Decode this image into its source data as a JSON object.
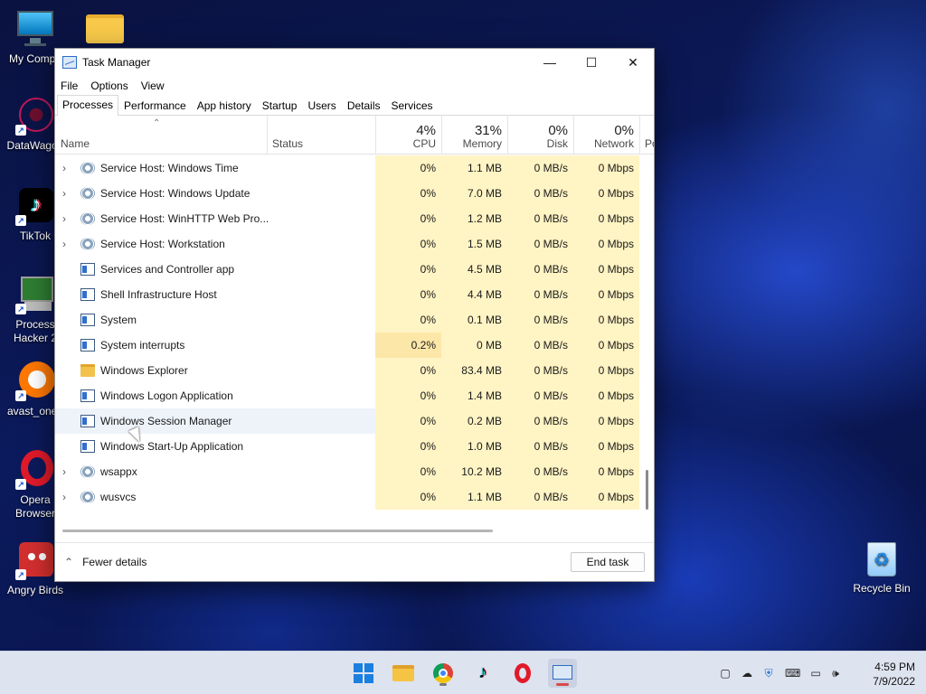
{
  "desktop": {
    "icons": [
      {
        "label": "My Compu",
        "icon": "monitor-icon"
      },
      {
        "label": "DataWagon",
        "icon": "datawagon-icon"
      },
      {
        "label": "TikTok",
        "icon": "tiktok-icon"
      },
      {
        "label": "Process Hacker 2",
        "icon": "process-hacker-icon"
      },
      {
        "label": "avast_one_",
        "icon": "avast-icon"
      },
      {
        "label": "Opera Browser",
        "icon": "opera-icon"
      },
      {
        "label": "Angry Birds",
        "icon": "angry-birds-icon"
      },
      {
        "label": "Recycle Bin",
        "icon": "recycle-bin-icon"
      }
    ]
  },
  "window": {
    "title": "Task Manager",
    "menu": [
      "File",
      "Options",
      "View"
    ],
    "tabs": [
      "Processes",
      "Performance",
      "App history",
      "Startup",
      "Users",
      "Details",
      "Services"
    ],
    "active_tab": "Processes",
    "columns": {
      "name": "Name",
      "status": "Status",
      "cpu": {
        "pct": "4%",
        "label": "CPU"
      },
      "memory": {
        "pct": "31%",
        "label": "Memory"
      },
      "disk": {
        "pct": "0%",
        "label": "Disk"
      },
      "network": {
        "pct": "0%",
        "label": "Network"
      },
      "power": "Po"
    },
    "rows": [
      {
        "name": "Service Host: Windows Time",
        "cpu": "0%",
        "memory": "1.1 MB",
        "disk": "0 MB/s",
        "network": "0 Mbps",
        "icon": "gear",
        "expandable": true
      },
      {
        "name": "Service Host: Windows Update",
        "cpu": "0%",
        "memory": "7.0 MB",
        "disk": "0 MB/s",
        "network": "0 Mbps",
        "icon": "gear",
        "expandable": true
      },
      {
        "name": "Service Host: WinHTTP Web Pro...",
        "cpu": "0%",
        "memory": "1.2 MB",
        "disk": "0 MB/s",
        "network": "0 Mbps",
        "icon": "gear",
        "expandable": true
      },
      {
        "name": "Service Host: Workstation",
        "cpu": "0%",
        "memory": "1.5 MB",
        "disk": "0 MB/s",
        "network": "0 Mbps",
        "icon": "gear",
        "expandable": true
      },
      {
        "name": "Services and Controller app",
        "cpu": "0%",
        "memory": "4.5 MB",
        "disk": "0 MB/s",
        "network": "0 Mbps",
        "icon": "window",
        "expandable": false
      },
      {
        "name": "Shell Infrastructure Host",
        "cpu": "0%",
        "memory": "4.4 MB",
        "disk": "0 MB/s",
        "network": "0 Mbps",
        "icon": "window",
        "expandable": false
      },
      {
        "name": "System",
        "cpu": "0%",
        "memory": "0.1 MB",
        "disk": "0 MB/s",
        "network": "0 Mbps",
        "icon": "window",
        "expandable": false
      },
      {
        "name": "System interrupts",
        "cpu": "0.2%",
        "memory": "0 MB",
        "disk": "0 MB/s",
        "network": "0 Mbps",
        "icon": "window",
        "expandable": false
      },
      {
        "name": "Windows Explorer",
        "cpu": "0%",
        "memory": "83.4 MB",
        "disk": "0 MB/s",
        "network": "0 Mbps",
        "icon": "folder",
        "expandable": false
      },
      {
        "name": "Windows Logon Application",
        "cpu": "0%",
        "memory": "1.4 MB",
        "disk": "0 MB/s",
        "network": "0 Mbps",
        "icon": "window",
        "expandable": false
      },
      {
        "name": "Windows Session Manager",
        "cpu": "0%",
        "memory": "0.2 MB",
        "disk": "0 MB/s",
        "network": "0 Mbps",
        "icon": "window",
        "expandable": false
      },
      {
        "name": "Windows Start-Up Application",
        "cpu": "0%",
        "memory": "1.0 MB",
        "disk": "0 MB/s",
        "network": "0 Mbps",
        "icon": "window",
        "expandable": false
      },
      {
        "name": "wsappx",
        "cpu": "0%",
        "memory": "10.2 MB",
        "disk": "0 MB/s",
        "network": "0 Mbps",
        "icon": "gear",
        "expandable": true
      },
      {
        "name": "wusvcs",
        "cpu": "0%",
        "memory": "1.1 MB",
        "disk": "0 MB/s",
        "network": "0 Mbps",
        "icon": "gear",
        "expandable": true
      }
    ],
    "footer": {
      "fewer_details": "Fewer details",
      "end_task": "End task"
    }
  },
  "taskbar": {
    "apps": [
      "start-icon",
      "file-explorer-icon",
      "chrome-icon",
      "tiktok-icon",
      "opera-icon",
      "task-manager-icon"
    ],
    "tray_icons": [
      "notification-icon",
      "cloud-off-icon",
      "shield-warning-icon",
      "keyboard-icon",
      "network-icon",
      "volume-icon"
    ],
    "time": "4:59 PM",
    "date": "7/9/2022"
  },
  "colors": {
    "accent": "#0067c0",
    "heat_light": "#fff4c4",
    "heat_medium": "#fde7a8"
  }
}
